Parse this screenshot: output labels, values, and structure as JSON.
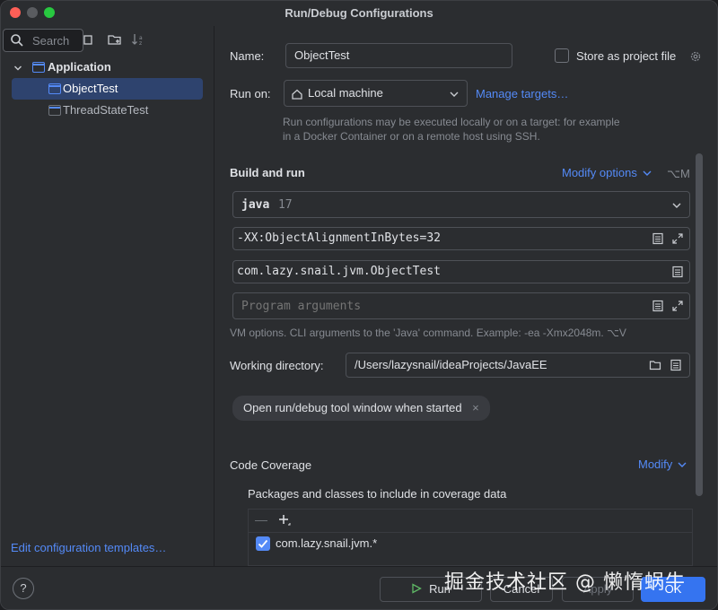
{
  "window": {
    "title": "Run/Debug Configurations"
  },
  "sidebar": {
    "search_placeholder": "Search",
    "tree": {
      "group_label": "Application",
      "items": [
        "ObjectTest",
        "ThreadStateTest"
      ]
    },
    "edit_templates_link": "Edit configuration templates…"
  },
  "form": {
    "name_label": "Name:",
    "name_value": "ObjectTest",
    "store_label": "Store as project file",
    "run_on_label": "Run on:",
    "run_on_value": "Local machine",
    "manage_targets": "Manage targets…",
    "run_on_hint": "Run configurations may be executed locally or on a target: for example in a Docker Container or on a remote host using SSH.",
    "build_run_title": "Build and run",
    "modify_options": "Modify options",
    "modify_options_shortcut": "⌥M",
    "jdk_name": "java",
    "jdk_version": "17",
    "vm_options": "-XX:ObjectAlignmentInBytes=32",
    "main_class": "com.lazy.snail.jvm.ObjectTest",
    "program_args_placeholder": "Program arguments",
    "vm_hint": "VM options. CLI arguments to the 'Java' command. Example: -ea -Xmx2048m. ⌥V",
    "working_dir_label": "Working directory:",
    "working_dir_value": "/Users/lazysnail/ideaProjects/JavaEE",
    "tool_window_chip": "Open run/debug tool window when started",
    "coverage_title": "Code Coverage",
    "coverage_modify": "Modify",
    "coverage_packages_label": "Packages and classes to include in coverage data",
    "coverage_entries": [
      "com.lazy.snail.jvm.*"
    ]
  },
  "footer": {
    "help": "?",
    "run": "Run",
    "cancel": "Cancel",
    "apply": "Apply",
    "ok": "OK"
  },
  "watermark": "掘金技术社区 @ 懒惰蜗牛",
  "colors": {
    "accent": "#548af7",
    "primary_button": "#3574f0",
    "selection": "#2e436e"
  }
}
